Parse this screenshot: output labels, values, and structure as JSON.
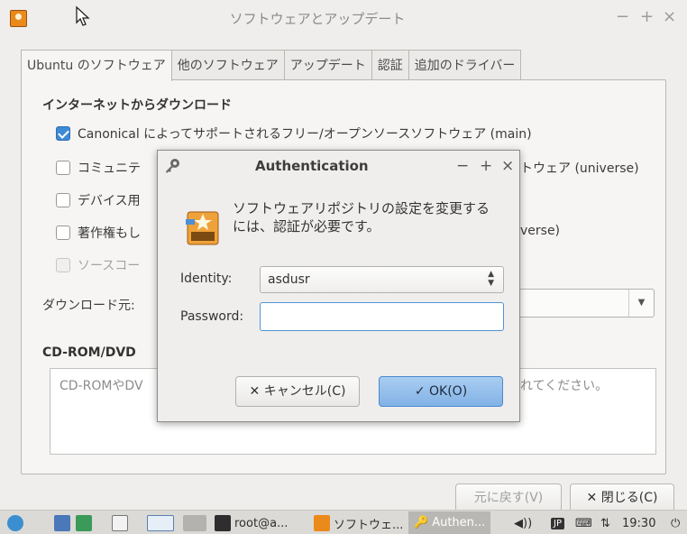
{
  "window": {
    "title": "ソフトウェアとアップデート",
    "controls": [
      "−",
      "+",
      "×"
    ]
  },
  "tabs": [
    {
      "label": "Ubuntu のソフトウェア",
      "active": true
    },
    {
      "label": "他のソフトウェア",
      "active": false
    },
    {
      "label": "アップデート",
      "active": false
    },
    {
      "label": "認証",
      "active": false
    },
    {
      "label": "追加のドライバー",
      "active": false
    }
  ],
  "download_section": {
    "heading": "インターネットからダウンロード",
    "options": [
      {
        "label": "Canonical によってサポートされるフリー/オープンソースソフトウェア (main)",
        "checked": true
      },
      {
        "label": "コミュニテ",
        "label_right": "トウェア (universe)",
        "checked": false
      },
      {
        "label": "デバイス用",
        "checked": false
      },
      {
        "label": "著作権もし",
        "label_right": "verse)",
        "checked": false
      },
      {
        "label": "ソースコー",
        "checked": false,
        "disabled": true
      }
    ],
    "download_from_label": "ダウンロード元:"
  },
  "cdrom_section": {
    "heading": "CD-ROM/DVD",
    "text_left": "CD-ROMやDV",
    "text_right": "れてください。"
  },
  "bottom_buttons": {
    "revert": "元に戻す(V)",
    "close": "✕ 閉じる(C)"
  },
  "auth_dialog": {
    "title": "Authentication",
    "controls": [
      "−",
      "+",
      "×"
    ],
    "message_line1": "ソフトウェアリポジトリの設定を変更する",
    "message_line2": "には、認証が必要です。",
    "identity_label": "Identity:",
    "identity_value": "asdusr",
    "password_label": "Password:",
    "password_value": "",
    "cancel_label": "✕ キャンセル(C)",
    "ok_label": "✓ OK(O)"
  },
  "panel": {
    "tasks": [
      {
        "label": "root@a...",
        "icon": "terminal-icon"
      },
      {
        "label": "ソフトウェ...",
        "icon": "software-icon"
      },
      {
        "label": "Authen...",
        "icon": "key-icon"
      }
    ],
    "ime": "JP",
    "clock": "19:30"
  }
}
